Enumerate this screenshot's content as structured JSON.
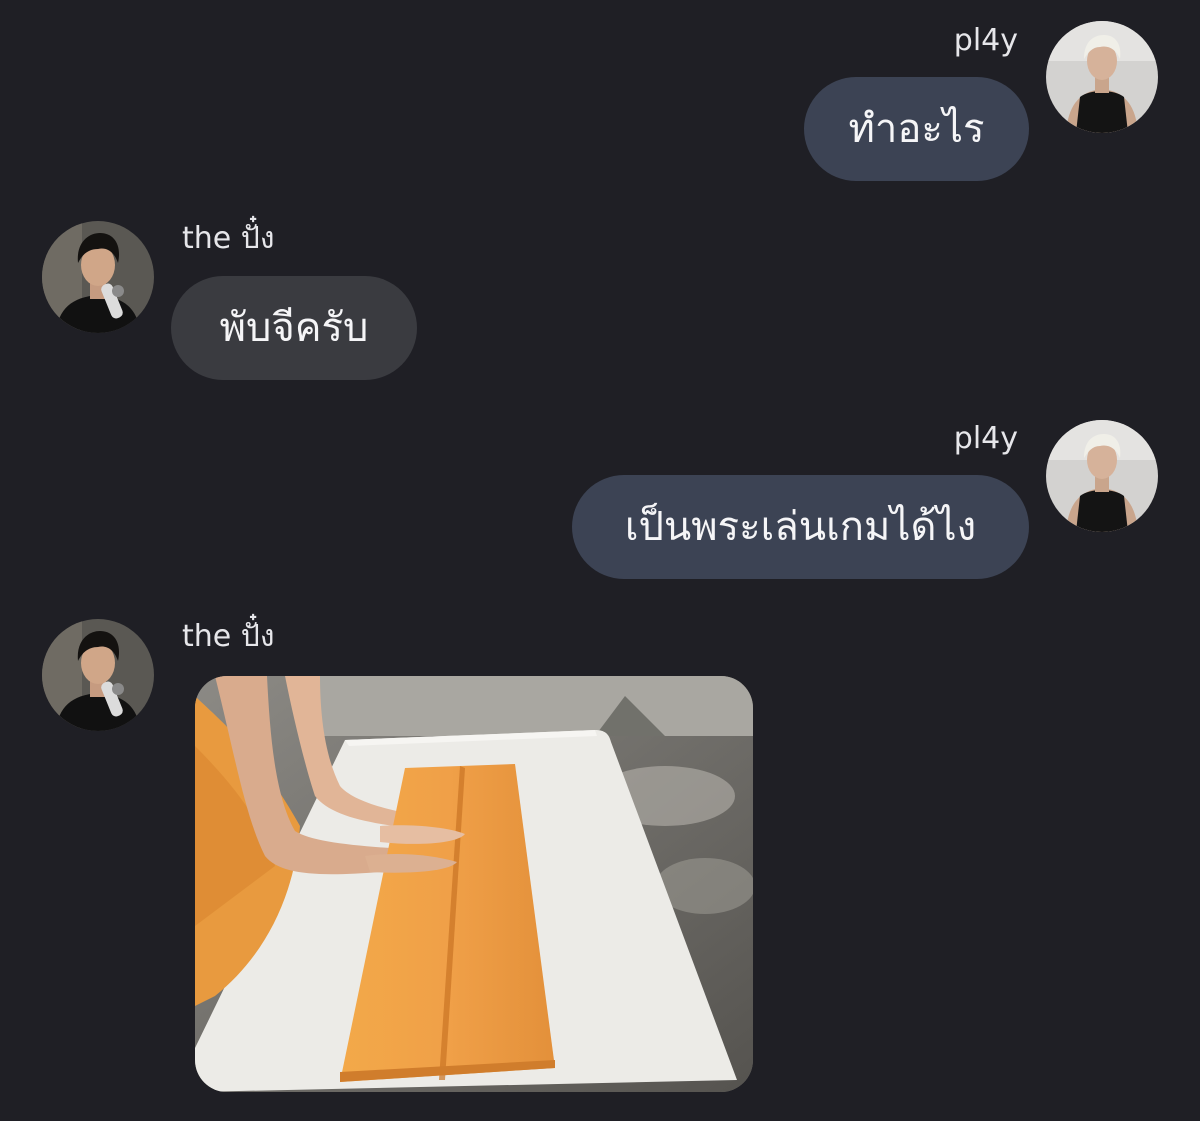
{
  "messages": [
    {
      "direction": "outgoing",
      "sender": "pl4y",
      "type": "text",
      "text": "ทำอะไร"
    },
    {
      "direction": "incoming",
      "sender": "the ปั๋ง",
      "type": "text",
      "text": "พับจีครับ"
    },
    {
      "direction": "outgoing",
      "sender": "pl4y",
      "type": "text",
      "text": "เป็นพระเล่นเกมได้ไง"
    },
    {
      "direction": "incoming",
      "sender": "the ปั๋ง",
      "type": "image"
    }
  ],
  "colors": {
    "background": "#1f1f25",
    "outgoing_bubble": "#3c4354",
    "incoming_bubble": "#3a3b40",
    "text": "#f5f5f7",
    "sender_name": "#e6e6ea",
    "robe": "#f0a048"
  }
}
